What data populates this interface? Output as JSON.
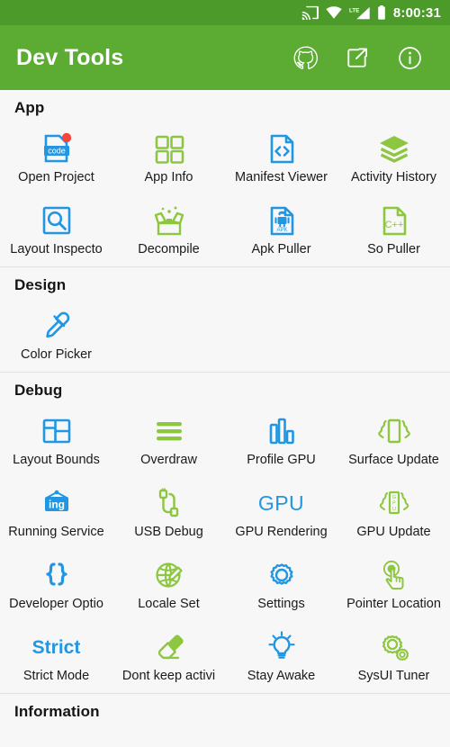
{
  "statusbar": {
    "icons": [
      "cast-icon",
      "wifi-icon",
      "lte-signal-icon",
      "battery-icon"
    ],
    "network_label": "LTE",
    "time": "8:00:31"
  },
  "appbar": {
    "title": "Dev Tools",
    "actions": [
      {
        "name": "github-icon",
        "label": "GitHub"
      },
      {
        "name": "share-icon",
        "label": "Share"
      },
      {
        "name": "info-icon",
        "label": "About"
      }
    ]
  },
  "colors": {
    "statusbar_green": "#4C9A2A",
    "appbar_green": "#5CAB33",
    "background": "#F7F7F7",
    "icon_blue": "#2196E3",
    "icon_green": "#8DC63F",
    "badge_red": "#F4463C",
    "divider": "#E2E2E2",
    "text": "#1a1a1a"
  },
  "sections": [
    {
      "id": "app",
      "title": "App",
      "items": [
        {
          "label": "Open Project",
          "icon": "code-document-icon",
          "color": "#2196E3",
          "badge": true
        },
        {
          "label": "App Info",
          "icon": "grid-squares-icon",
          "color": "#8DC63F"
        },
        {
          "label": "Manifest Viewer",
          "icon": "code-brackets-file-icon",
          "color": "#2196E3"
        },
        {
          "label": "Activity History",
          "icon": "layers-stack-icon",
          "color": "#8DC63F"
        },
        {
          "label": "Layout Inspecto",
          "icon": "magnifier-frame-icon",
          "color": "#2196E3"
        },
        {
          "label": "Decompile",
          "icon": "open-box-icon",
          "color": "#8DC63F"
        },
        {
          "label": "Apk Puller",
          "icon": "apk-file-icon",
          "color": "#2196E3",
          "badge_text": "APK"
        },
        {
          "label": "So Puller",
          "icon": "cpp-file-icon",
          "color": "#8DC63F",
          "badge_text": "C++"
        }
      ]
    },
    {
      "id": "design",
      "title": "Design",
      "items": [
        {
          "label": "Color Picker",
          "icon": "eyedropper-icon",
          "color": "#2196E3"
        }
      ]
    },
    {
      "id": "debug",
      "title": "Debug",
      "items": [
        {
          "label": "Layout Bounds",
          "icon": "layout-bounds-icon",
          "color": "#2196E3"
        },
        {
          "label": "Overdraw",
          "icon": "three-bars-icon",
          "color": "#8DC63F"
        },
        {
          "label": "Profile GPU",
          "icon": "bar-chart-icon",
          "color": "#2196E3"
        },
        {
          "label": "Surface Update",
          "icon": "surface-update-icon",
          "color": "#8DC63F"
        },
        {
          "label": "Running Service",
          "icon": "ing-sign-icon",
          "color": "#2196E3",
          "badge_text": "ing"
        },
        {
          "label": "USB Debug",
          "icon": "usb-cable-icon",
          "color": "#8DC63F"
        },
        {
          "label": "GPU Rendering",
          "icon": "gpu-text-icon",
          "color": "#2196E3",
          "badge_text": "GPU"
        },
        {
          "label": "GPU Update",
          "icon": "gpu-update-icon",
          "color": "#8DC63F",
          "badge_text": "GPU"
        },
        {
          "label": "Developer Optio",
          "icon": "curly-braces-icon",
          "color": "#2196E3",
          "badge_text": "{ }"
        },
        {
          "label": "Locale Set",
          "icon": "globe-pencil-icon",
          "color": "#8DC63F"
        },
        {
          "label": "Settings",
          "icon": "gear-icon",
          "color": "#2196E3"
        },
        {
          "label": "Pointer Location",
          "icon": "pointer-touch-icon",
          "color": "#8DC63F"
        },
        {
          "label": "Strict Mode",
          "icon": "strict-text-icon",
          "color": "#2196E3",
          "badge_text": "Strict"
        },
        {
          "label": "Dont keep activi",
          "icon": "eraser-icon",
          "color": "#8DC63F"
        },
        {
          "label": "Stay Awake",
          "icon": "lightbulb-icon",
          "color": "#2196E3"
        },
        {
          "label": "SysUI Tuner",
          "icon": "gears-icon",
          "color": "#8DC63F"
        }
      ]
    },
    {
      "id": "information",
      "title": "Information",
      "items": []
    }
  ]
}
